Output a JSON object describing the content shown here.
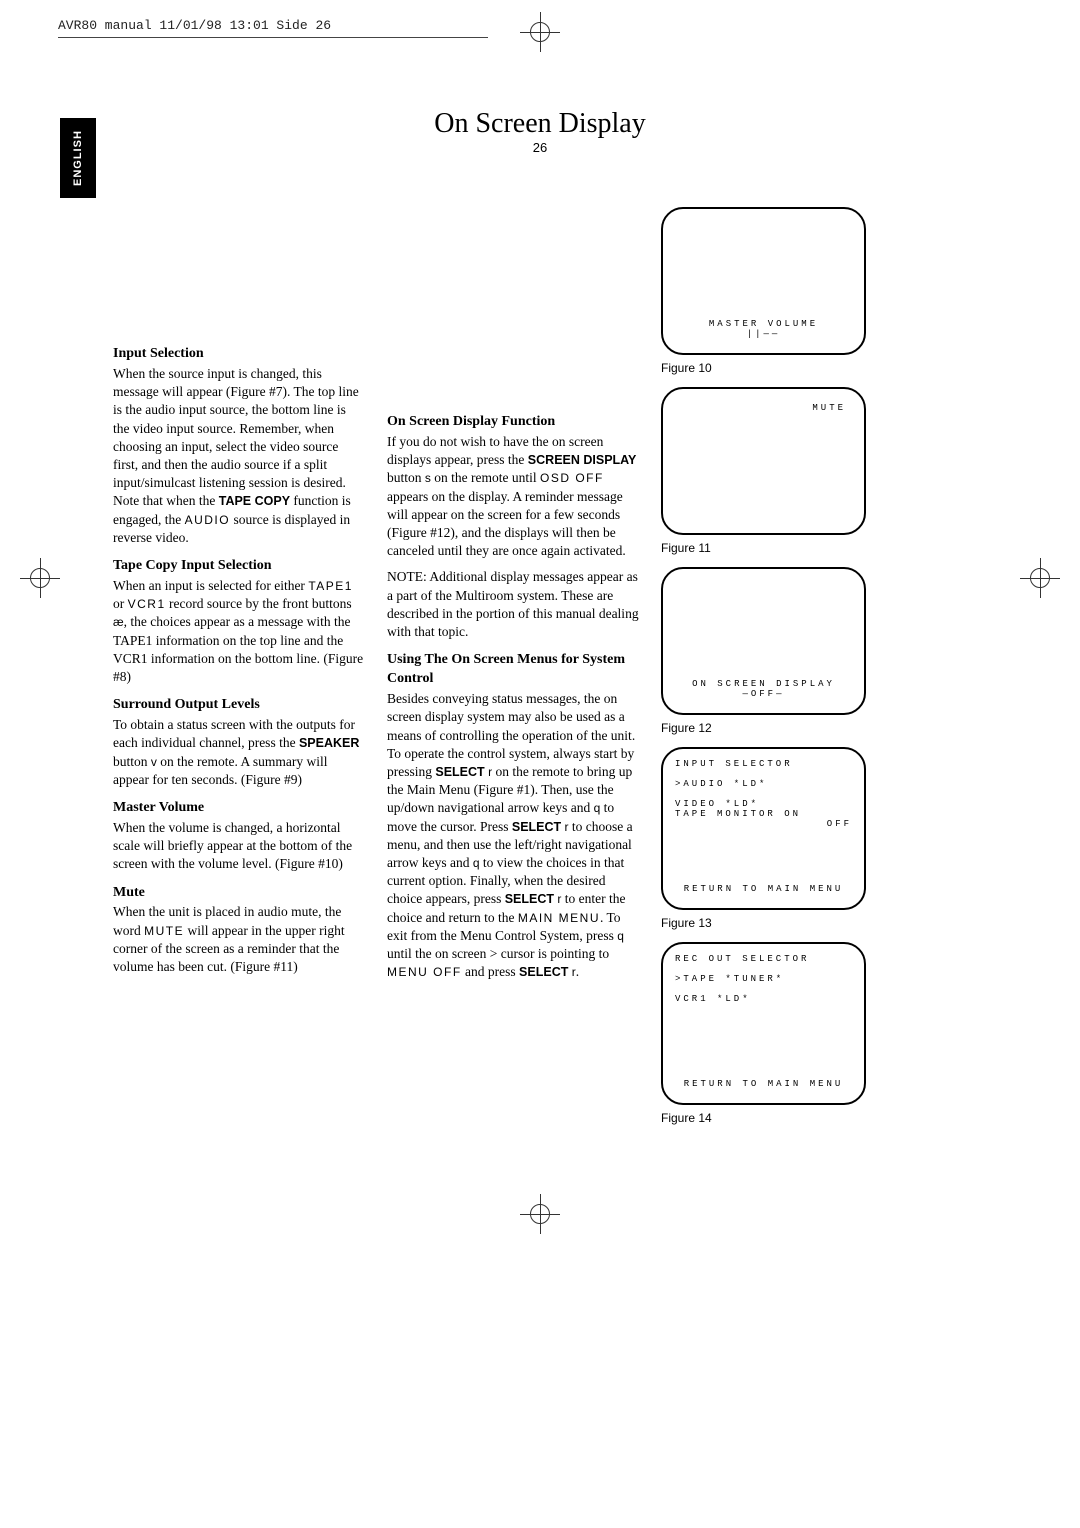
{
  "print_header": "AVR80 manual  11/01/98 13:01  Side 26",
  "language_tab": "ENGLISH",
  "page_title": "On Screen Display",
  "page_number": "26",
  "col1": {
    "h1": "Input Selection",
    "p1_a": "When the source input is changed, this message will appear (Figure #7). The top line is the audio input source, the bottom line is the video input source. Remember, when choosing an input, select the video source first, and then the audio source if a split input/simulcast listening session is desired. Note that when the ",
    "p1_bold1": "TAPE COPY",
    "p1_b": " function is engaged, the ",
    "p1_mono1": "AUDIO",
    "p1_c": " source is displayed in reverse video.",
    "h2": "Tape Copy Input Selection",
    "p2_a": "When an input is selected for either ",
    "p2_m1": "TAPE1",
    "p2_b": " or ",
    "p2_m2": "VCR1",
    "p2_c": " record source by the front buttons ",
    "p2_i1": "æ",
    "p2_d": ", the choices appear as a message with the TAPE1 information on the top line and the VCR1 information on the bottom line. (Figure #8)",
    "h3": "Surround Output Levels",
    "p3_a": "To obtain a status screen with the outputs for each individual channel, press the ",
    "p3_bold1": "SPEAKER",
    "p3_b": " button ",
    "p3_i1": "v",
    "p3_c": " on the remote. A summary will appear for ten seconds. (Figure #9)",
    "h4": "Master Volume",
    "p4": "When the volume is changed, a horizontal scale will briefly appear at the bottom of the screen with the volume level. (Figure #10)",
    "h5": "Mute",
    "p5_a": "When the unit is placed in audio mute, the word ",
    "p5_m1": "MUTE",
    "p5_b": " will appear in the upper right corner of the screen as a reminder that the volume has been cut. (Figure #11)"
  },
  "col2": {
    "h1": "On Screen Display Function",
    "p1_a": "If you do not wish to have the on screen displays appear, press the ",
    "p1_bold1": "SCREEN DISPLAY",
    "p1_b": " button ",
    "p1_i1": "s",
    "p1_c": " on the remote until ",
    "p1_m1": "OSD OFF",
    "p1_d": " appears on the display. A reminder message will appear on the screen for a few seconds (Figure #12), and the displays will then be canceled until they are once again activated.",
    "p2": "NOTE: Additional display messages appear as a part of the Multiroom system. These are described in the portion of this manual dealing with that topic.",
    "h2": "Using The On Screen Menus for System Control",
    "p3_a": "Besides conveying status messages, the on screen display system may also be used as a means of controlling the operation of the unit. To operate the control system, always start by pressing ",
    "p3_bold1": "SELECT",
    "p3_i1": "r",
    "p3_b": " on the remote to bring up the Main Menu (Figure #1). Then, use the up/down navigational arrow keys ",
    "p3_i2": " and ",
    "p3_i3": "q",
    "p3_c": " to move the cursor. Press ",
    "p3_bold2": "SELECT",
    "p3_i4": "r",
    "p3_d": " to choose a menu, and then use the left/right navigational arrow keys ",
    "p3_i5": " and ",
    "p3_i6": "q",
    "p3_e": " to view the choices in that current option. Finally, when the desired choice appears, press ",
    "p3_bold3": "SELECT",
    "p3_i7": "r",
    "p3_f": " to enter the choice and return to the ",
    "p3_m1": "MAIN MENU",
    "p3_g": ". To exit from the Menu Control System, press ",
    "p3_i8": "q",
    "p3_h": " until the on screen ",
    "p3_gt": ">",
    "p3_i": " cursor is pointing to ",
    "p3_m2": "MENU OFF",
    "p3_j": " and press ",
    "p3_bold4": "SELECT",
    "p3_i9": "r",
    "p3_k": "."
  },
  "figures": {
    "f10": {
      "line1": "MASTER VOLUME",
      "line2": "||——",
      "label": "Figure 10"
    },
    "f11": {
      "line1": "MUTE",
      "label": "Figure 11"
    },
    "f12": {
      "line1": "ON SCREEN DISPLAY",
      "line2": "—OFF—",
      "label": "Figure 12"
    },
    "f13": {
      "l1": "INPUT SELECTOR",
      "l2": ">AUDIO *LD*",
      "l3": " VIDEO *LD*",
      "l4": " TAPE MONITOR  ON",
      "l5": "                OFF",
      "l6": "RETURN TO MAIN MENU",
      "label": "Figure 13"
    },
    "f14": {
      "l1": "REC OUT SELECTOR",
      "l2": ">TAPE *TUNER*",
      "l3": " VCR1 *LD*",
      "l6": "RETURN TO MAIN MENU",
      "label": "Figure 14"
    }
  }
}
